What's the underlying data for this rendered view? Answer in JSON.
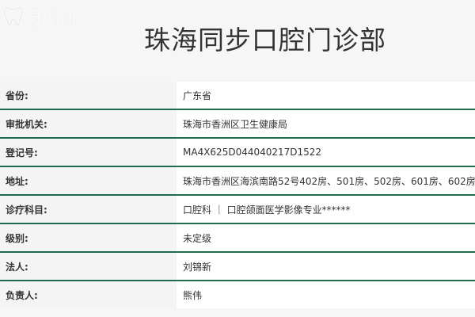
{
  "watermark": {
    "text": "牙舒丽",
    "icon": "tooth-icon"
  },
  "page": {
    "title": "珠海同步口腔门诊部"
  },
  "rows": [
    {
      "label": "省份:",
      "value": "广东省"
    },
    {
      "label": "审批机关:",
      "value": "珠海市香洲区卫生健康局"
    },
    {
      "label": "登记号:",
      "value": "MA4X625D044040217D1522"
    },
    {
      "label": "地址:",
      "value": "珠海市香洲区海滨南路52号402房、501房、502房、601房、602房"
    },
    {
      "label": "诊疗科目:",
      "value": "口腔科 ｜ 口腔颌面医学影像专业******"
    },
    {
      "label": "级别:",
      "value": "未定级"
    },
    {
      "label": "法人:",
      "value": "刘锦新"
    },
    {
      "label": "负责人:",
      "value": "熊伟"
    }
  ],
  "colors": {
    "divider": "#1f6b4b",
    "label_bg": "#f4f4f4",
    "value_bg": "#ffffff",
    "text": "#333333"
  }
}
